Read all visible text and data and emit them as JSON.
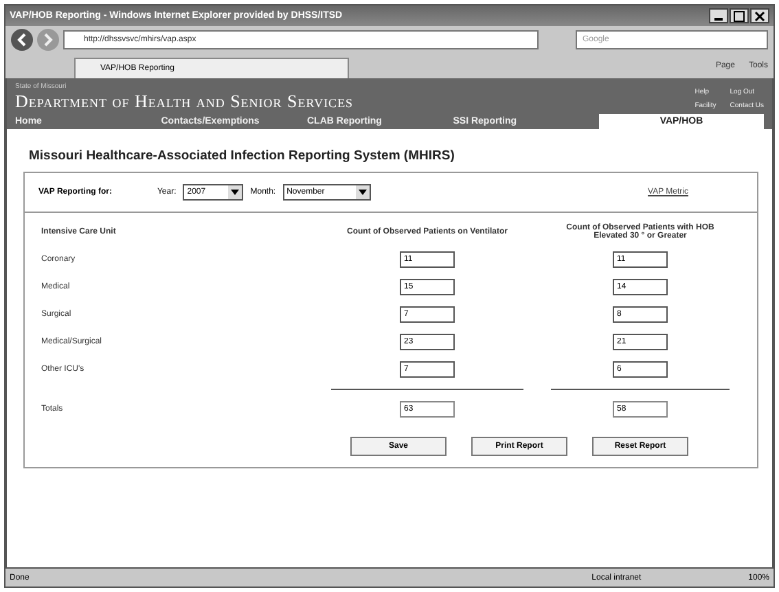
{
  "window": {
    "title": "VAP/HOB Reporting - Windows Internet Explorer provided by DHSS/ITSD"
  },
  "browser": {
    "address": "http://dhssvsvc/mhirs/vap.aspx",
    "search_placeholder": "Google",
    "tab": "VAP/HOB Reporting",
    "commands": [
      "Page",
      "Tools"
    ]
  },
  "header": {
    "agency": "State of Missouri",
    "title": "Department of Health and Senior Services",
    "links": [
      "Help",
      "Log Out",
      "Facility",
      "Contact Us"
    ]
  },
  "nav": [
    {
      "label": "Home",
      "selected": false
    },
    {
      "label": "Contacts/Exemptions",
      "selected": false
    },
    {
      "label": "CLAB Reporting",
      "selected": false
    },
    {
      "label": "SSI Reporting",
      "selected": false
    },
    {
      "label": "VAP/HOB",
      "selected": true
    }
  ],
  "page_title": "Missouri Healthcare-Associated Infection Reporting System (MHIRS)",
  "filter": {
    "label": "VAP Reporting for:",
    "year_label": "Year:",
    "year": "2007",
    "month_label": "Month:",
    "month": "November",
    "link": "VAP Metric"
  },
  "table": {
    "columns": [
      "Intensive Care Unit",
      "Count of Observed Patients on Ventilator",
      "Count of Observed Patients with HOB Elevated 30 ° or Greater"
    ],
    "rows": [
      {
        "unit": "Coronary",
        "ventilator": "11",
        "hob": "11"
      },
      {
        "unit": "Medical",
        "ventilator": "15",
        "hob": "14"
      },
      {
        "unit": "Surgical",
        "ventilator": "7",
        "hob": "8"
      },
      {
        "unit": "Medical/Surgical",
        "ventilator": "23",
        "hob": "21"
      },
      {
        "unit": "Other ICU's",
        "ventilator": "7",
        "hob": "6"
      }
    ],
    "totals": {
      "label": "Totals",
      "ventilator": "63",
      "hob": "58"
    }
  },
  "buttons": [
    "Save",
    "Print Report",
    "Reset Report"
  ],
  "status_bar": {
    "text": "Done",
    "zone": "Local intranet",
    "zoom": "100%"
  }
}
